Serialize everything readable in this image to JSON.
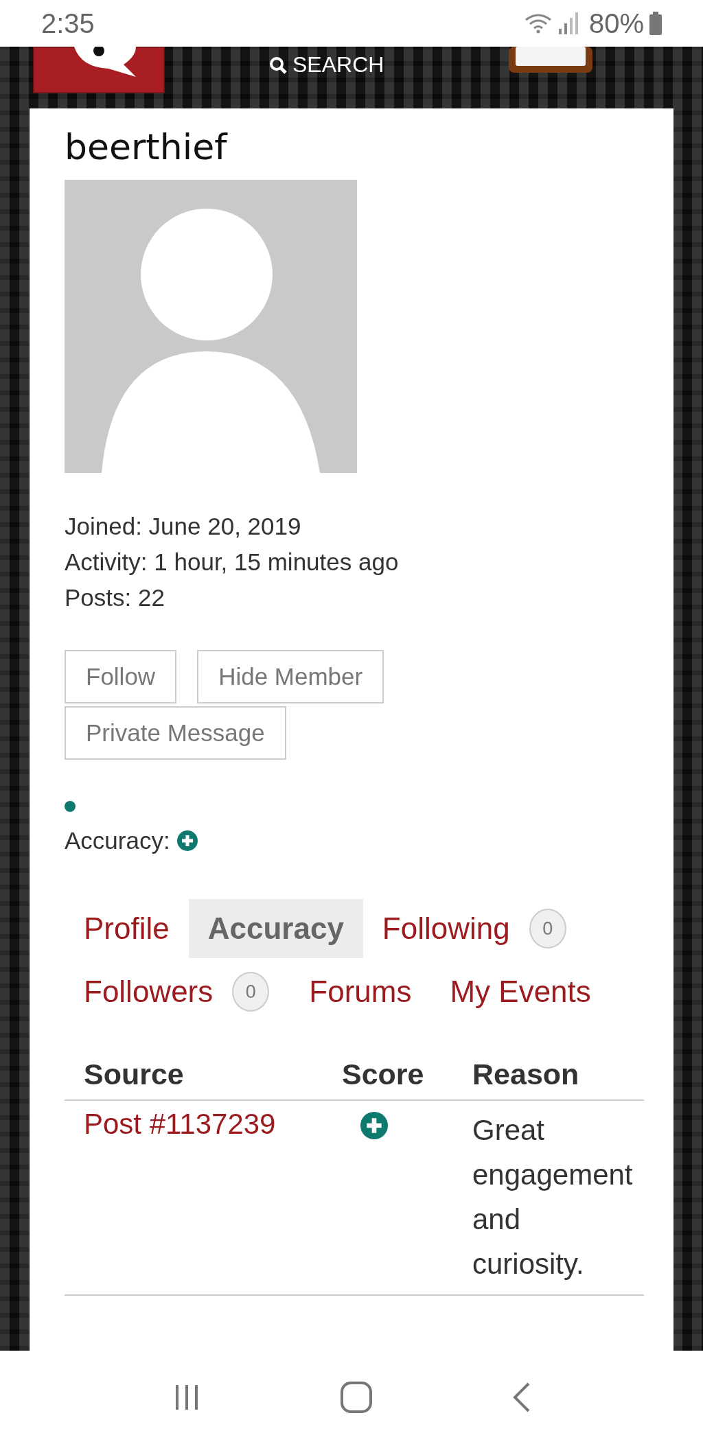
{
  "status_bar": {
    "time": "2:35",
    "battery": "80%"
  },
  "header": {
    "search": "SEARCH"
  },
  "profile": {
    "username": "beerthief",
    "stats": [
      "Joined: June 20, 2019",
      "Activity: 1 hour, 15 minutes ago",
      "Posts: 22"
    ],
    "buttons": [
      "Follow",
      "Hide Member",
      "Private Message"
    ],
    "accuracy": {
      "label": "Accuracy:",
      "kind": "plus"
    }
  },
  "tabs": [
    {
      "label": "Profile",
      "selected": false
    },
    {
      "label": "Accuracy",
      "selected": true
    },
    {
      "label": "Following",
      "selected": false,
      "count": "0"
    },
    {
      "label": "Followers",
      "selected": false,
      "count": "0"
    },
    {
      "label": "Forums",
      "selected": false
    },
    {
      "label": "My Events",
      "selected": false
    }
  ],
  "table": {
    "columns": [
      "Source",
      "Score",
      "Reason"
    ],
    "rows": [
      {
        "source": "Post #1137239",
        "score": {
          "kind": "plus"
        },
        "reason": "Great engagement and curiosity."
      }
    ]
  }
}
